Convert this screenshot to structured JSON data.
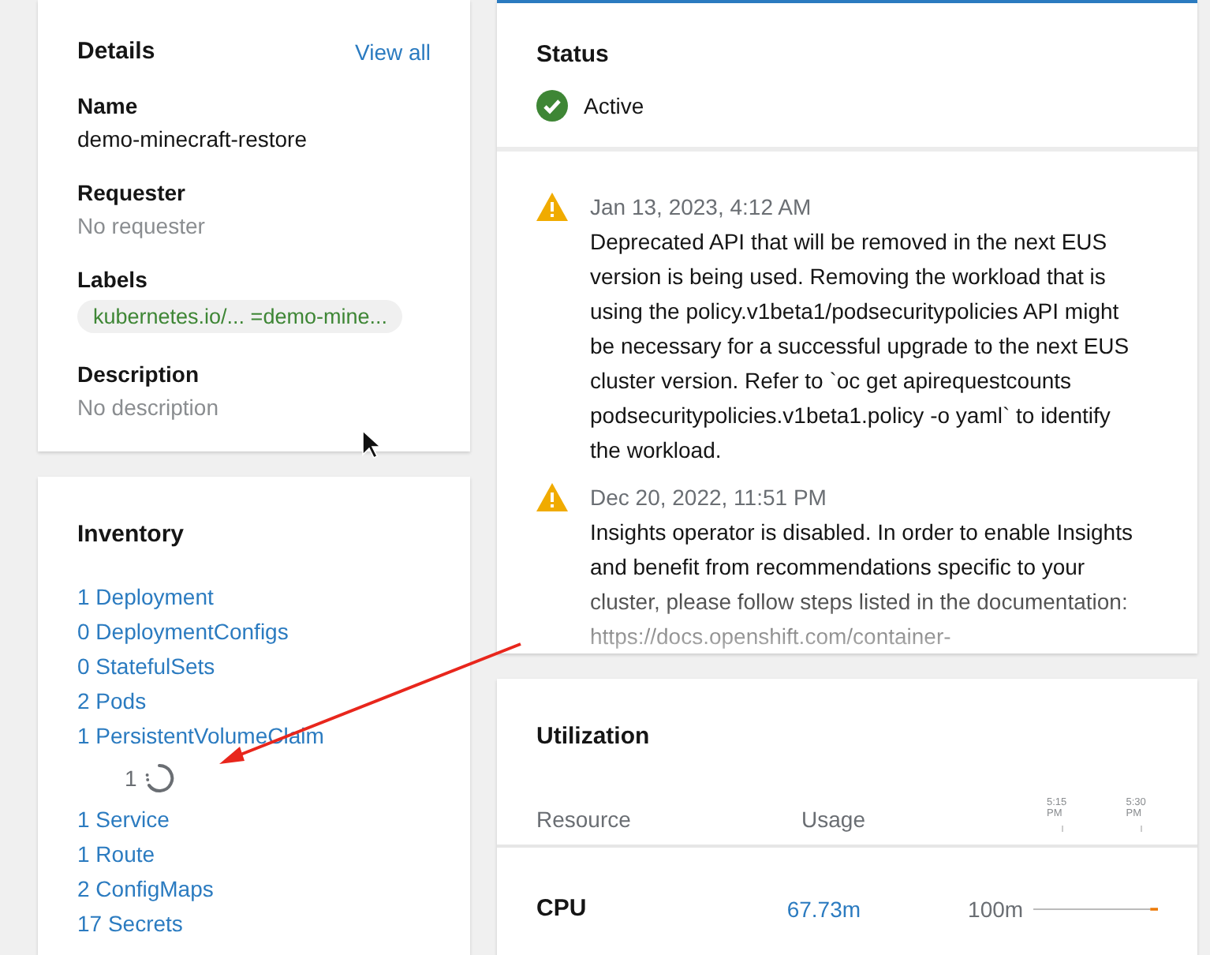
{
  "details": {
    "title": "Details",
    "view_all": "View all",
    "fields": [
      {
        "kind": "text",
        "label": "Name",
        "value": "demo-minecraft-restore"
      },
      {
        "kind": "empty",
        "label": "Requester",
        "value": "No requester"
      },
      {
        "kind": "label",
        "label": "Labels",
        "value": "kubernetes.io/... =demo-mine..."
      },
      {
        "kind": "empty",
        "label": "Description",
        "value": "No description"
      }
    ]
  },
  "inventory": {
    "title": "Inventory",
    "items": [
      {
        "kind": "link",
        "text": "1 Deployment"
      },
      {
        "kind": "link",
        "text": "0 DeploymentConfigs"
      },
      {
        "kind": "link",
        "text": "0 StatefulSets"
      },
      {
        "kind": "link",
        "text": "2 Pods"
      },
      {
        "kind": "link",
        "text": "1 PersistentVolumeClaim"
      },
      {
        "kind": "loading",
        "text": "1"
      },
      {
        "kind": "link",
        "text": "1 Service"
      },
      {
        "kind": "link",
        "text": "1 Route"
      },
      {
        "kind": "link",
        "text": "2 ConfigMaps"
      },
      {
        "kind": "link",
        "text": "17 Secrets"
      }
    ]
  },
  "status": {
    "title": "Status",
    "state": "Active",
    "ok": true
  },
  "events": [
    {
      "kind": "warning",
      "time": "Jan 13, 2023, 4:12 AM",
      "message": "Deprecated API that will be removed in the next EUS version is being used. Removing the workload that is using the policy.v1beta1/podsecuritypolicies API might be necessary for a successful upgrade to the next EUS cluster version. Refer to `oc get apirequestcounts podsecuritypolicies.v1beta1.policy -o yaml` to identify the workload."
    },
    {
      "kind": "warning",
      "time": "Dec 20, 2022, 11:51 PM",
      "message": "Insights operator is disabled. In order to enable Insights and benefit from recommendations specific to your cluster, please follow steps listed in the documentation: https://docs.openshift.com/container-"
    }
  ],
  "utilization": {
    "title": "Utilization",
    "columns": [
      "Resource",
      "Usage"
    ],
    "time_ticks": [
      "5:15 PM",
      "5:30 PM"
    ],
    "rows": [
      {
        "resource": "CPU",
        "usage": "67.73m",
        "limit": "100m"
      }
    ]
  }
}
